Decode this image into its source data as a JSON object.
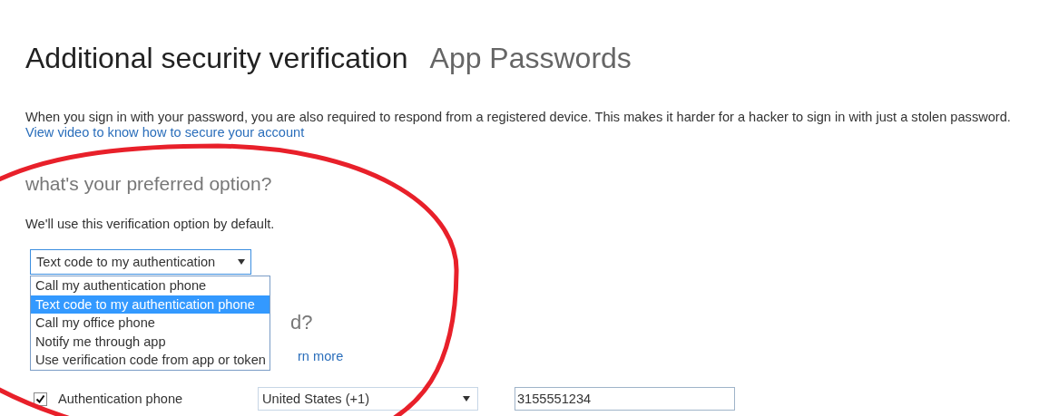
{
  "title": "Additional security verification",
  "title_link": "App Passwords",
  "intro": "When you sign in with your password, you are also required to respond from a registered device. This makes it harder for a hacker to sign in with just a stolen password.",
  "video_link": "View video to know how to secure your account",
  "preferred": {
    "heading": "what's your preferred option?",
    "hint": "We'll use this verification option by default.",
    "select_value": "Text code to my authentication",
    "options": [
      {
        "label": "Call my authentication phone",
        "selected": false
      },
      {
        "label": "Text code to my authentication phone",
        "selected": true
      },
      {
        "label": "Call my office phone",
        "selected": false
      },
      {
        "label": "Notify me through app",
        "selected": false
      },
      {
        "label": "Use verification code from app or token",
        "selected": false
      }
    ]
  },
  "covered_heading": {
    "end": "d?"
  },
  "covered_line": {
    "end": "rn more"
  },
  "phone_row": {
    "checked": true,
    "label": "Authentication phone",
    "country": "United States (+1)",
    "number": "3155551234"
  }
}
